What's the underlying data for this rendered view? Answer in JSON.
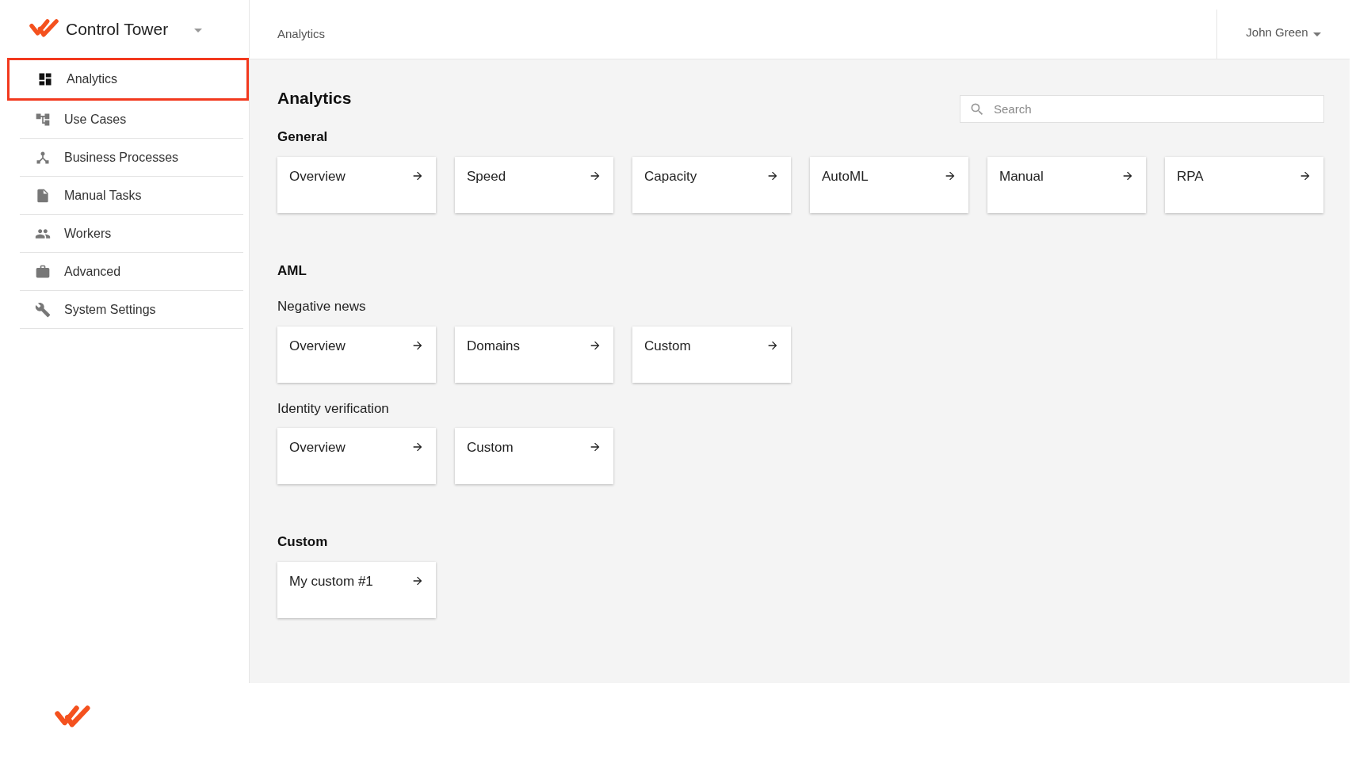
{
  "app": {
    "title": "Control Tower"
  },
  "sidebar": {
    "items": [
      {
        "label": "Analytics",
        "selected": true
      },
      {
        "label": "Use Cases",
        "selected": false
      },
      {
        "label": "Business Processes",
        "selected": false
      },
      {
        "label": "Manual Tasks",
        "selected": false
      },
      {
        "label": "Workers",
        "selected": false
      },
      {
        "label": "Advanced",
        "selected": false
      },
      {
        "label": "System Settings",
        "selected": false
      }
    ]
  },
  "header": {
    "breadcrumb": "Analytics",
    "user": "John Green"
  },
  "page": {
    "title": "Analytics",
    "search": {
      "placeholder": "Search"
    }
  },
  "sections": [
    {
      "title": "General",
      "groups": [
        {
          "cards": [
            "Overview",
            "Speed",
            "Capacity",
            "AutoML",
            "Manual",
            "RPA"
          ]
        }
      ]
    },
    {
      "title": "AML",
      "groups": [
        {
          "subtitle": "Negative news",
          "cards": [
            "Overview",
            "Domains",
            "Custom"
          ]
        },
        {
          "subtitle": "Identity verification",
          "cards": [
            "Overview",
            "Custom"
          ]
        }
      ]
    },
    {
      "title": "Custom",
      "groups": [
        {
          "cards": [
            "My custom #1"
          ]
        }
      ]
    }
  ]
}
